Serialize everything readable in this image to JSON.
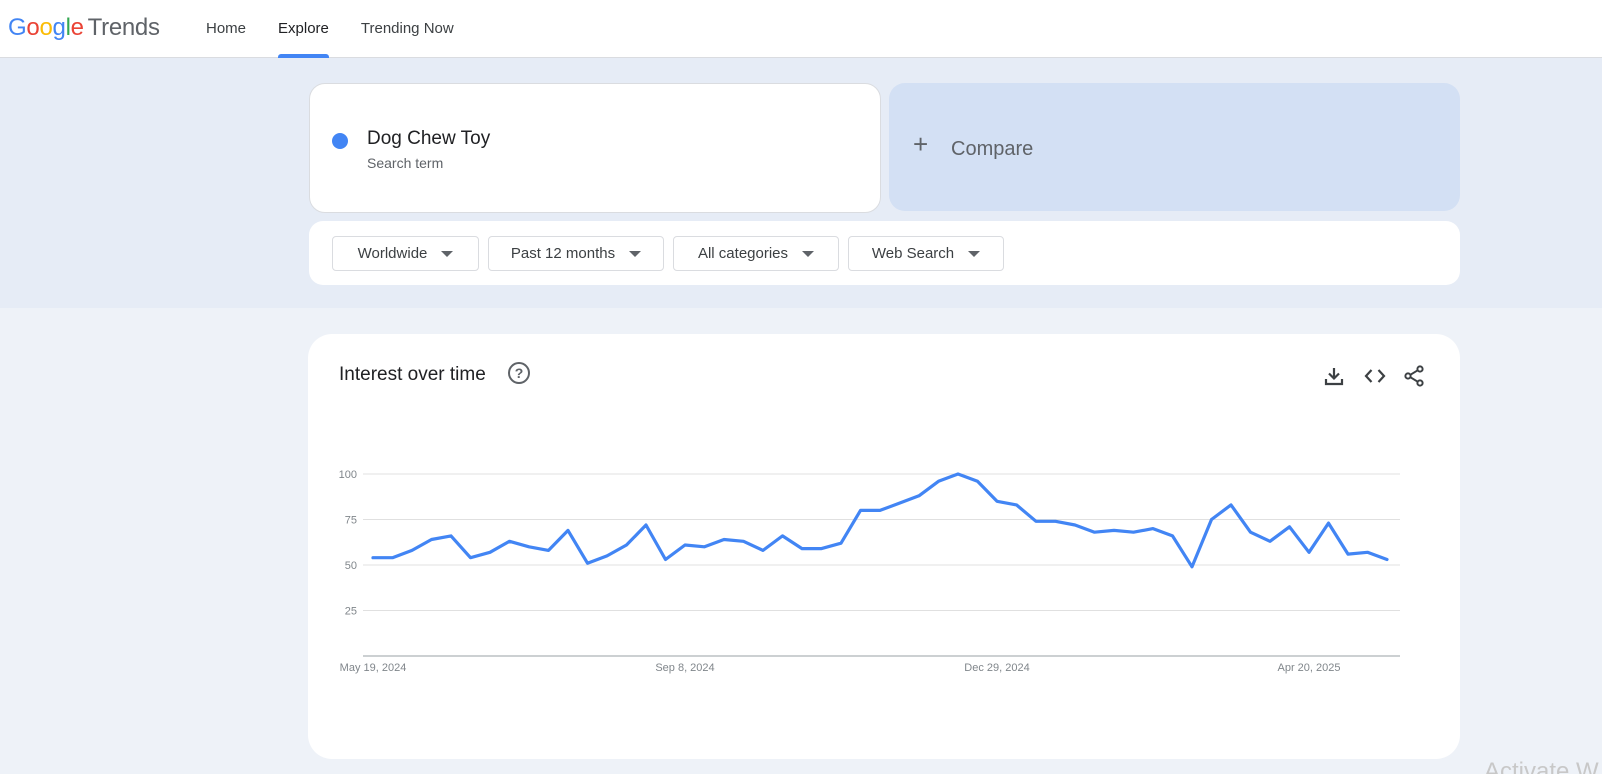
{
  "header": {
    "logo": {
      "google_letters": [
        "G",
        "o",
        "o",
        "g",
        "l",
        "e"
      ],
      "letter_colors": [
        "#4285f4",
        "#ea4335",
        "#fbbc05",
        "#4285f4",
        "#34a853",
        "#ea4335"
      ],
      "product": "Trends"
    },
    "nav": [
      {
        "label": "Home",
        "active": false
      },
      {
        "label": "Explore",
        "active": true
      },
      {
        "label": "Trending Now",
        "active": false
      }
    ],
    "accent_color": "#4285f4"
  },
  "search_term": {
    "name": "Dog Chew Toy",
    "subtitle": "Search term",
    "color": "#4285f4"
  },
  "compare": {
    "icon": "plus-icon",
    "label": "Compare"
  },
  "filters": [
    {
      "label": "Worldwide",
      "icon": "dropdown-arrow-icon"
    },
    {
      "label": "Past 12 months",
      "icon": "dropdown-arrow-icon"
    },
    {
      "label": "All categories",
      "icon": "dropdown-arrow-icon"
    },
    {
      "label": "Web Search",
      "icon": "dropdown-arrow-icon"
    }
  ],
  "interest_panel": {
    "title": "Interest over time",
    "icons": [
      "help-icon",
      "download-icon",
      "embed-code-icon",
      "share-icon"
    ]
  },
  "chart_data": {
    "type": "line",
    "title": "",
    "xlabel": "",
    "ylabel": "",
    "ylim": [
      0,
      100
    ],
    "yticks": [
      25,
      50,
      75,
      100
    ],
    "grid": true,
    "x_ticks": [
      {
        "label": "May 19, 2024",
        "index": 0
      },
      {
        "label": "Sep 8, 2024",
        "index": 16
      },
      {
        "label": "Dec 29, 2024",
        "index": 32
      },
      {
        "label": "Apr 20, 2025",
        "index": 48
      }
    ],
    "series": [
      {
        "color": "#4285f4",
        "values": [
          54,
          54,
          58,
          64,
          66,
          54,
          57,
          63,
          60,
          58,
          69,
          51,
          55,
          61,
          72,
          53,
          61,
          60,
          64,
          63,
          58,
          66,
          59,
          59,
          62,
          80,
          80,
          84,
          88,
          96,
          100,
          96,
          85,
          83,
          74,
          74,
          72,
          68,
          69,
          68,
          70,
          66,
          49,
          75,
          83,
          68,
          63,
          71,
          57,
          73,
          56,
          57,
          53
        ]
      }
    ]
  },
  "watermark": "Activate W"
}
